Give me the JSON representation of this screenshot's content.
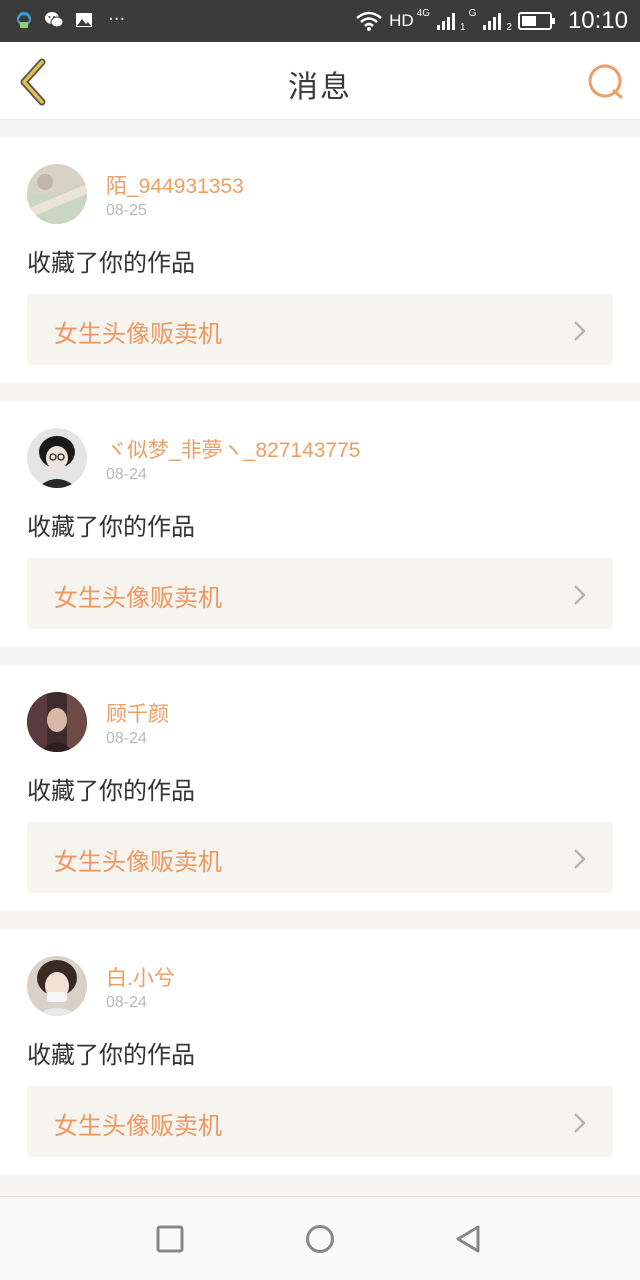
{
  "status_bar": {
    "left_icons": [
      "notification-icon",
      "wechat-icon",
      "image-icon",
      "more-dots-icon"
    ],
    "more": "···",
    "network": "HD",
    "sim1_type": "4G",
    "sim1_index": "1",
    "sim2_type": "G",
    "sim2_index": "2",
    "time": "10:10"
  },
  "header": {
    "title": "消息",
    "back_icon": "chevron-left-icon",
    "search_icon": "search-icon"
  },
  "colors": {
    "accent": "#ef9e63",
    "back": "#e2c24a",
    "link_bg": "#f5f4ef",
    "text": "#333333",
    "date": "#b9b9b9"
  },
  "messages": [
    {
      "username": "陌_944931353",
      "date": "08-25",
      "action": "收藏了你的作品",
      "work_title": "女生头像贩卖机"
    },
    {
      "username": "ヾ似梦_非夢ヽ_827143775",
      "date": "08-24",
      "action": "收藏了你的作品",
      "work_title": "女生头像贩卖机"
    },
    {
      "username": "顾千颜",
      "date": "08-24",
      "action": "收藏了你的作品",
      "work_title": "女生头像贩卖机"
    },
    {
      "username": "白.小兮",
      "date": "08-24",
      "action": "收藏了你的作品",
      "work_title": "女生头像贩卖机"
    }
  ],
  "nav_bar": {
    "icons": [
      "recents-square-icon",
      "home-circle-icon",
      "back-triangle-icon"
    ]
  }
}
